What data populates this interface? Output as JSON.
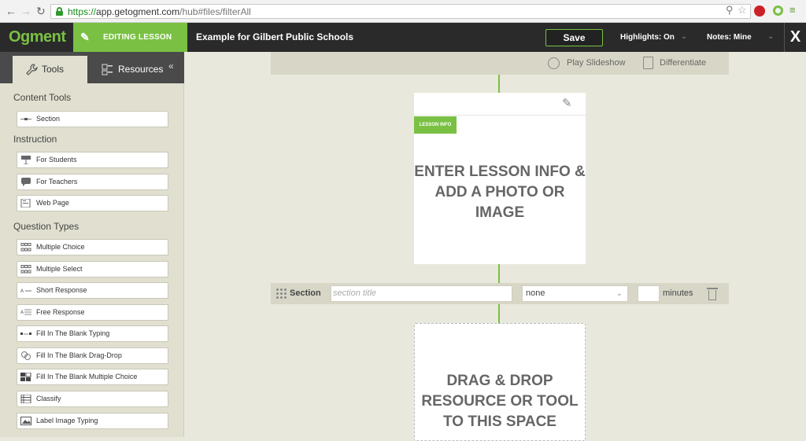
{
  "browser": {
    "url_proto": "https://",
    "url_host": "app.getogment.com",
    "url_path": "/hub#files/filterAll"
  },
  "header": {
    "logo": "Ogment",
    "editing_label": "EDITING LESSON",
    "lesson_title": "Example for Gilbert Public Schools",
    "save_label": "Save",
    "highlights_label": "Highlights: On",
    "notes_label": "Notes: Mine",
    "close_label": "X"
  },
  "sidebar": {
    "tabs": [
      {
        "label": "Tools",
        "icon": "wrench-icon"
      },
      {
        "label": "Resources",
        "icon": "resources-icon"
      }
    ],
    "collapse_label": "«",
    "sections": [
      {
        "title": "Content Tools",
        "items": [
          {
            "label": "Section",
            "icon": "section-icon"
          }
        ]
      },
      {
        "title": "Instruction",
        "items": [
          {
            "label": "For Students",
            "icon": "presentation-icon"
          },
          {
            "label": "For Teachers",
            "icon": "speech-bubble-icon"
          },
          {
            "label": "Web Page",
            "icon": "web-page-icon"
          }
        ]
      },
      {
        "title": "Question Types",
        "items": [
          {
            "label": "Multiple Choice",
            "icon": "grid-dots-icon"
          },
          {
            "label": "Multiple Select",
            "icon": "grid-dots-icon"
          },
          {
            "label": "Short Response",
            "icon": "short-response-icon"
          },
          {
            "label": "Free Response",
            "icon": "free-response-icon"
          },
          {
            "label": "Fill In The Blank Typing",
            "icon": "fill-blank-icon"
          },
          {
            "label": "Fill In The Blank Drag-Drop",
            "icon": "drag-drop-icon"
          },
          {
            "label": "Fill In The Blank Multiple Choice",
            "icon": "blocks-icon"
          },
          {
            "label": "Classify",
            "icon": "classify-icon"
          },
          {
            "label": "Label Image Typing",
            "icon": "image-label-icon"
          }
        ]
      }
    ]
  },
  "toolbar": {
    "play_label": "Play Slideshow",
    "differentiate_label": "Differentiate"
  },
  "lesson_card": {
    "badge": "LESSON INFO",
    "line1": "ENTER LESSON INFO &",
    "line2": "ADD A PHOTO OR",
    "line3": "IMAGE"
  },
  "section_row": {
    "label": "Section",
    "title_placeholder": "section title",
    "select_value": "none",
    "minutes_label": "minutes"
  },
  "dropzone": {
    "line1": "DRAG & DROP",
    "line2": "RESOURCE OR TOOL",
    "line3": "TO THIS SPACE"
  },
  "colors": {
    "accent_green": "#7ac143",
    "header_dark": "#2a2a2a",
    "sidebar_bg": "#e1e0d0"
  }
}
